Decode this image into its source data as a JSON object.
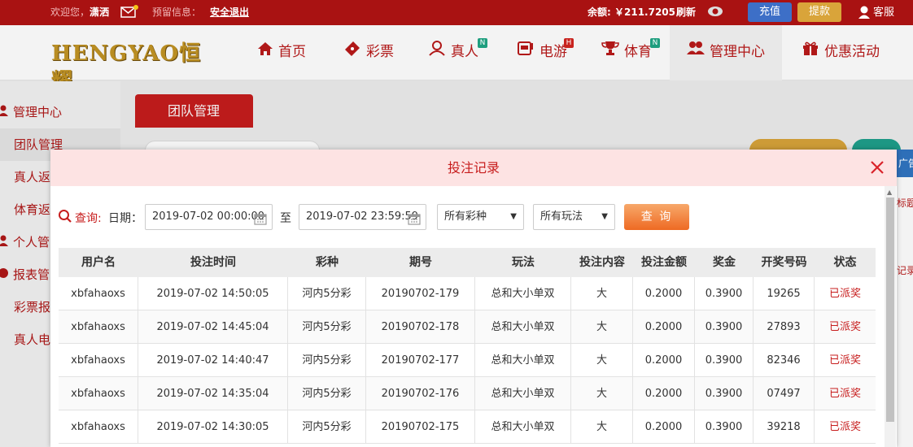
{
  "topbar": {
    "welcome": "欢迎您，",
    "username": "潇洒",
    "notice": "预留信息：",
    "logout": "安全退出",
    "balance_label": "余额:",
    "balance_value": "￥211.7205",
    "refresh": "刷新",
    "deposit": "充值",
    "withdraw": "提款",
    "service": "客服"
  },
  "logo": "HENGYAO恒耀",
  "nav": [
    {
      "label": "首页",
      "icon": "home-icon"
    },
    {
      "label": "彩票",
      "icon": "ticket-icon"
    },
    {
      "label": "真人",
      "icon": "person-icon",
      "badge": "N"
    },
    {
      "label": "电游",
      "icon": "slot-machine-icon",
      "badge": "H"
    },
    {
      "label": "体育",
      "icon": "trophy-icon",
      "badge": "N"
    },
    {
      "label": "管理中心",
      "icon": "users-icon"
    },
    {
      "label": "优惠活动",
      "icon": "gift-icon"
    }
  ],
  "sidebar": [
    {
      "label": "管理中心"
    },
    {
      "label": "团队管理"
    },
    {
      "label": "真人返"
    },
    {
      "label": "体育返"
    },
    {
      "label": "个人管"
    },
    {
      "label": "报表管"
    },
    {
      "label": "彩票报"
    },
    {
      "label": "真人电"
    }
  ],
  "main_tab": "团队管理",
  "right_fragments": [
    "广告",
    "标题",
    "记录"
  ],
  "modal": {
    "title": "投注记录",
    "query_label": "查询:",
    "date_label": "日期：",
    "start_date": "2019-07-02 00:00:00",
    "to_label": "至",
    "end_date": "2019-07-02 23:59:59",
    "lottery_select": "所有彩种",
    "play_select": "所有玩法",
    "query_button": "查 询",
    "columns": [
      "用户名",
      "投注时间",
      "彩种",
      "期号",
      "玩法",
      "投注内容",
      "投注金额",
      "奖金",
      "开奖号码",
      "状态"
    ],
    "rows": [
      [
        "xbfahaoxs",
        "2019-07-02 14:50:05",
        "河内5分彩",
        "20190702-179",
        "总和大小单双",
        "大",
        "0.2000",
        "0.3900",
        "19265",
        "已派奖"
      ],
      [
        "xbfahaoxs",
        "2019-07-02 14:45:04",
        "河内5分彩",
        "20190702-178",
        "总和大小单双",
        "大",
        "0.2000",
        "0.3900",
        "27893",
        "已派奖"
      ],
      [
        "xbfahaoxs",
        "2019-07-02 14:40:47",
        "河内5分彩",
        "20190702-177",
        "总和大小单双",
        "大",
        "0.2000",
        "0.3900",
        "82346",
        "已派奖"
      ],
      [
        "xbfahaoxs",
        "2019-07-02 14:35:04",
        "河内5分彩",
        "20190702-176",
        "总和大小单双",
        "大",
        "0.2000",
        "0.3900",
        "07497",
        "已派奖"
      ],
      [
        "xbfahaoxs",
        "2019-07-02 14:30:05",
        "河内5分彩",
        "20190702-175",
        "总和大小单双",
        "大",
        "0.2000",
        "0.3900",
        "39218",
        "已派奖"
      ]
    ]
  },
  "colors": {
    "brand_red": "#a91212",
    "accent_red": "#c71d1d",
    "query_orange": "#ee6a23",
    "deposit_blue": "#3d6fc7",
    "withdraw_gold": "#d9a43a"
  }
}
